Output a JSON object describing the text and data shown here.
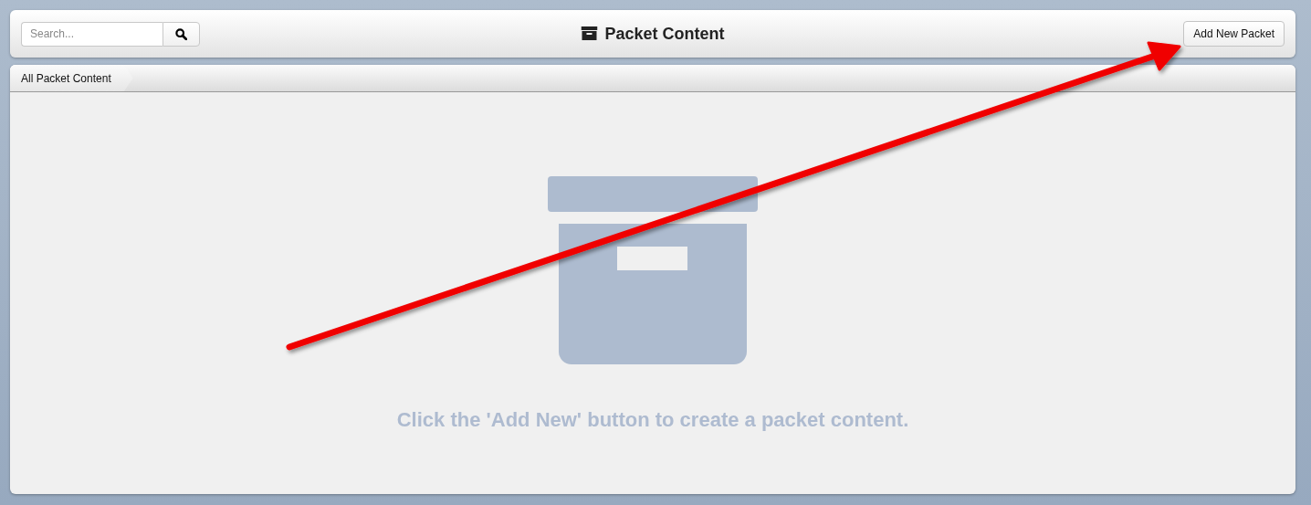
{
  "toolbar": {
    "search": {
      "placeholder": "Search..."
    },
    "title": "Packet Content",
    "add_button": "Add New Packet"
  },
  "breadcrumb": [
    "All Packet Content"
  ],
  "empty_state": {
    "message": "Click the 'Add New' button to create a packet content."
  }
}
